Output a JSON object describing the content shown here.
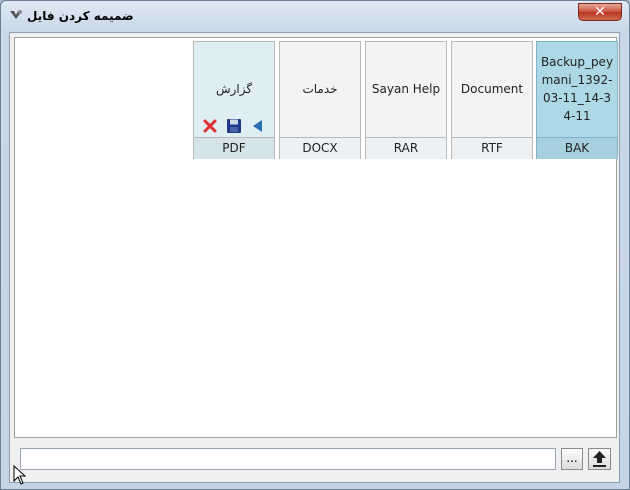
{
  "window": {
    "title": "ضمیمه کردن فایل",
    "close_label": "✕"
  },
  "files": [
    {
      "name": "گزارش",
      "type": "PDF",
      "state": "hover",
      "actions": [
        "play-icon",
        "save-icon",
        "delete-icon"
      ]
    },
    {
      "name": "خدمات",
      "type": "DOCX",
      "state": "normal"
    },
    {
      "name": "Sayan Help",
      "type": "RAR",
      "state": "normal"
    },
    {
      "name": "Document",
      "type": "RTF",
      "state": "normal"
    },
    {
      "name": "Backup_peymani_1392-03-11_14-34-11",
      "type": "BAK",
      "state": "selected"
    }
  ],
  "bottom_bar": {
    "path_value": "",
    "browse_label": "...",
    "upload_icon": "upload-arrow-icon"
  },
  "colors": {
    "selected_tile": "#add8e6",
    "hover_tile": "#dfeef2",
    "delete": "#e03030",
    "save": "#1f3a8a",
    "play": "#2a6fb0"
  }
}
